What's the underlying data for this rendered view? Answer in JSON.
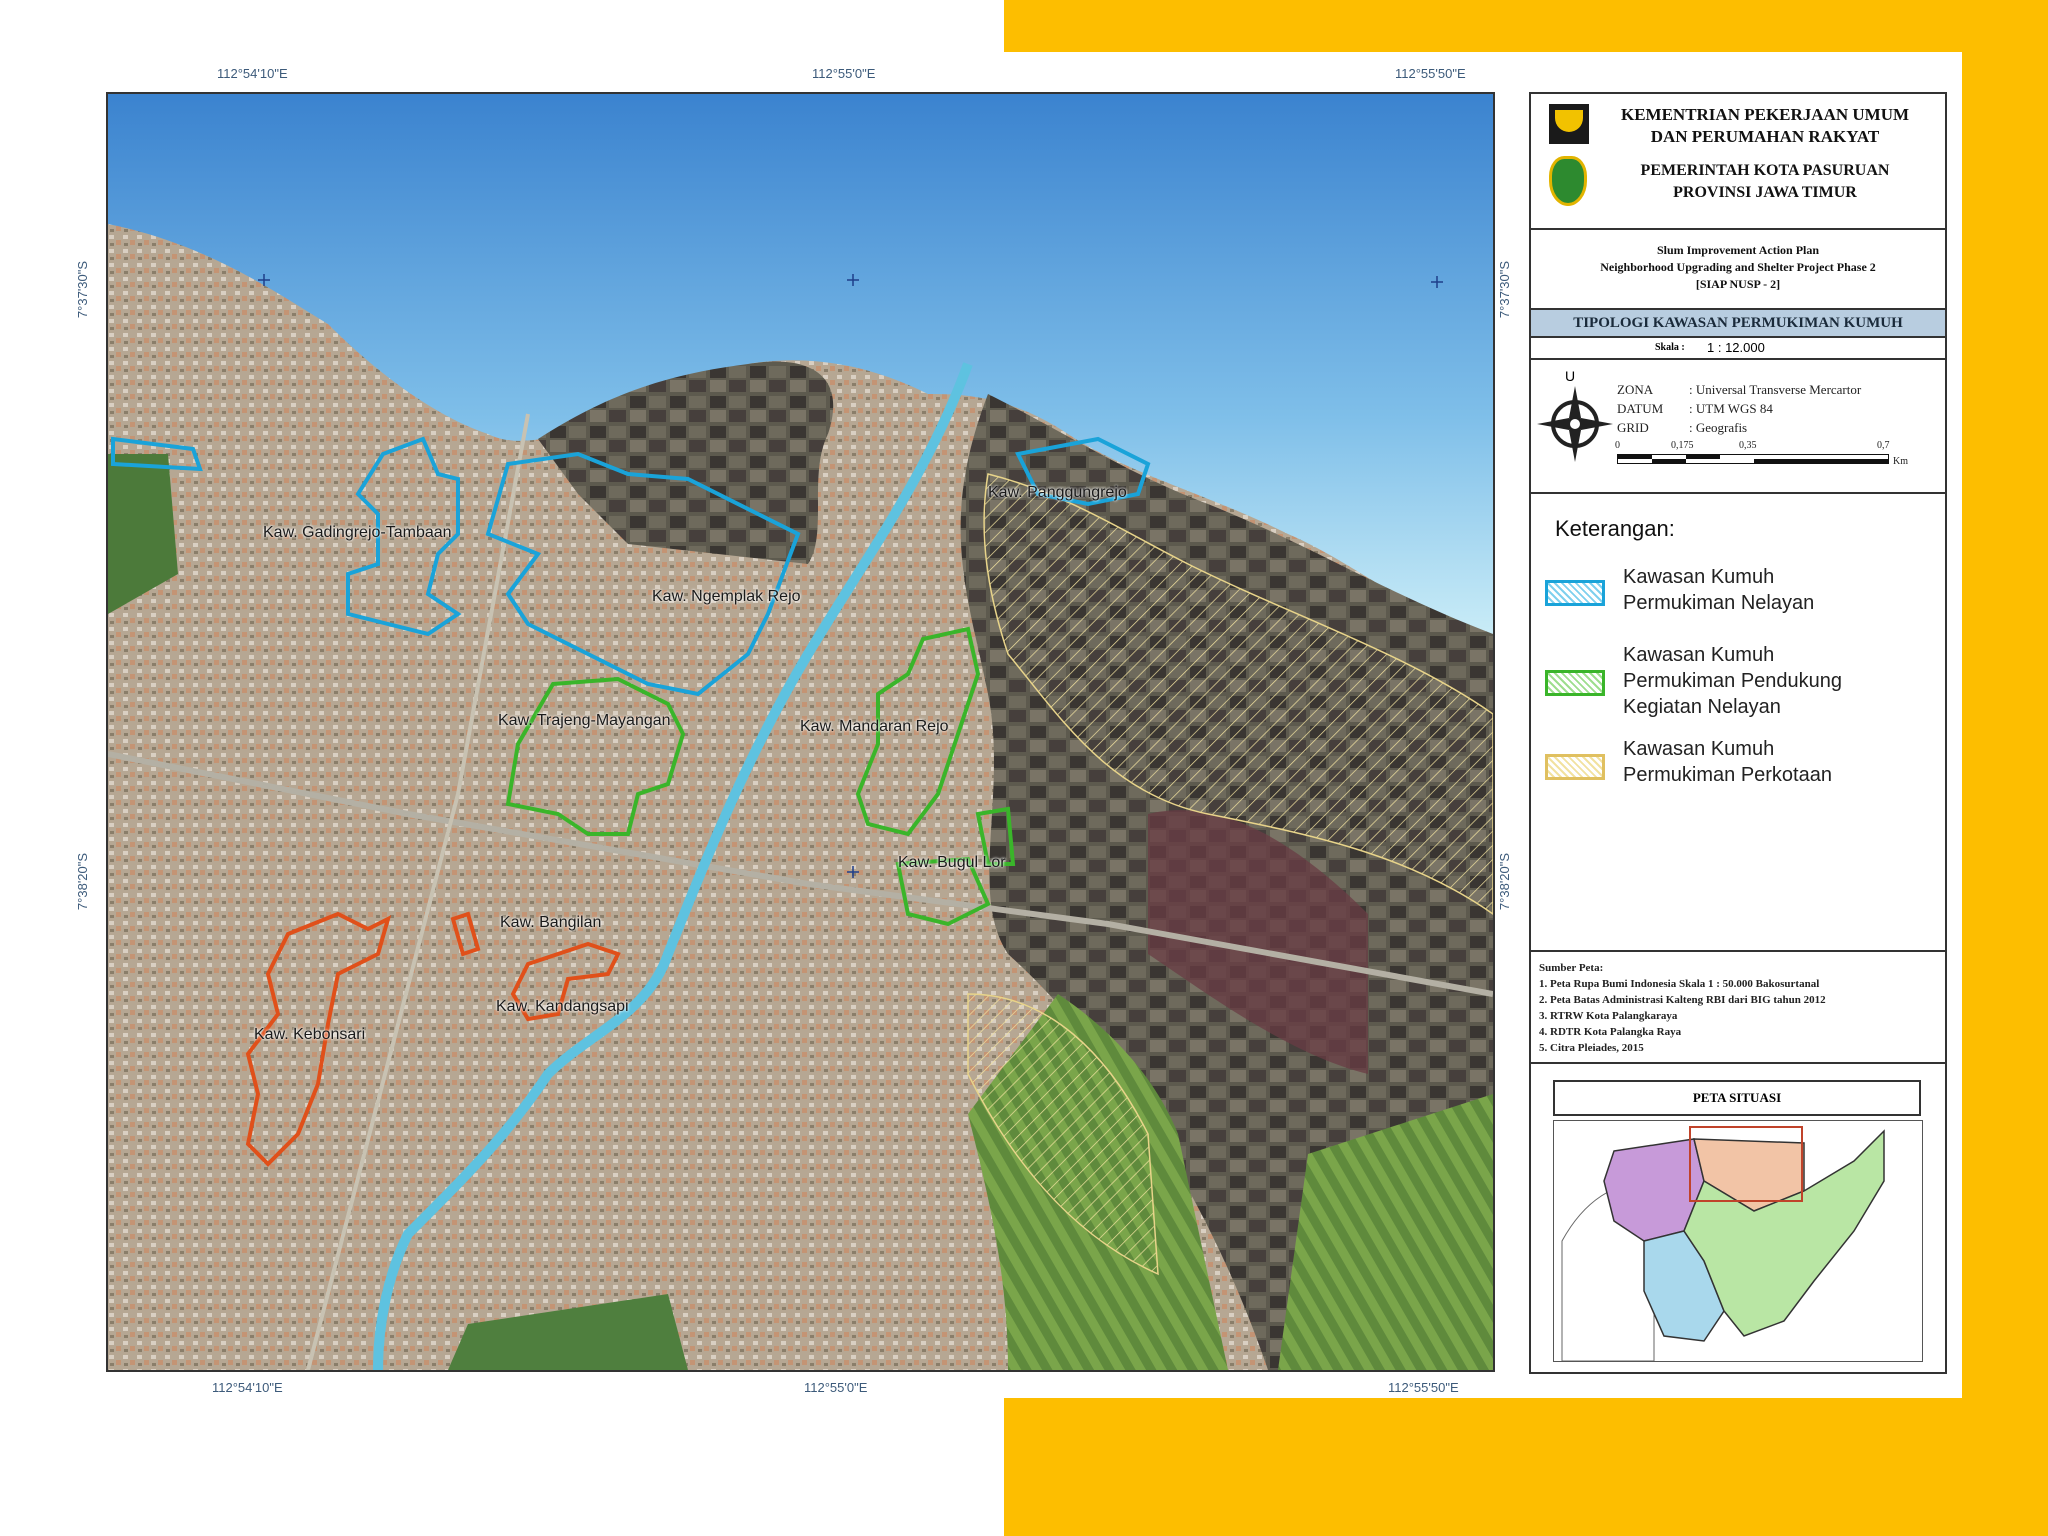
{
  "coords": {
    "top": [
      "112°54'10\"E",
      "112°55'0\"E",
      "112°55'50\"E"
    ],
    "bottom": [
      "112°54'10\"E",
      "112°55'0\"E",
      "112°55'50\"E"
    ],
    "left": [
      "7°37'30\"S",
      "7°38'20\"S"
    ],
    "right": [
      "7°37'30\"S",
      "7°38'20\"S"
    ]
  },
  "map_labels": {
    "gadingrejo": "Kaw. Gadingrejo-Tambaan",
    "ngemplak": "Kaw. Ngemplak Rejo",
    "panggungrejo": "Kaw. Panggungrejo",
    "trajeng": "Kaw. Trajeng-Mayangan",
    "mandaran": "Kaw. Mandaran Rejo",
    "bugul": "Kaw. Bugul Lor",
    "bangilan": "Kaw. Bangilan",
    "kebonsari": "Kaw. Kebonsari",
    "kandangsapi": "Kaw. Kandangsapi"
  },
  "header": {
    "ministry_line1": "KEMENTRIAN PEKERJAAN UMUM",
    "ministry_line2": "DAN PERUMAHAN RAKYAT",
    "gov_line1": "PEMERINTAH KOTA PASURUAN",
    "gov_line2": "PROVINSI JAWA TIMUR"
  },
  "project": {
    "line1": "Slum Improvement Action Plan",
    "line2": "Neighborhood Upgrading and Shelter Project Phase 2",
    "line3": "[SIAP NUSP - 2]"
  },
  "map_title": "TIPOLOGI KAWASAN PERMUKIMAN KUMUH",
  "scale": {
    "label": "Skala :",
    "value": "1 : 12.000"
  },
  "projection": {
    "zona_label": "ZONA",
    "zona_value": ": Universal Transverse Mercartor",
    "datum_label": "DATUM",
    "datum_value": ": UTM WGS 84",
    "grid_label": "GRID",
    "grid_value": ": Geografis",
    "north": "U",
    "ticks": [
      "0",
      "0,175",
      "0,35",
      "0,7"
    ],
    "unit": "Km"
  },
  "legend": {
    "title": "Keterangan:",
    "items": [
      {
        "line1": "Kawasan Kumuh",
        "line2": "Permukiman Nelayan",
        "line3": "",
        "color": "#1aa3d9"
      },
      {
        "line1": "Kawasan Kumuh",
        "line2": "Permukiman Pendukung",
        "line3": "Kegiatan Nelayan",
        "color": "#3ab52a"
      },
      {
        "line1": "Kawasan Kumuh",
        "line2": "Permukiman Perkotaan",
        "line3": "",
        "color": "#e0c060"
      }
    ]
  },
  "sources": {
    "title": "Sumber Peta:",
    "items": [
      "1. Peta Rupa Bumi Indonesia Skala 1 : 50.000 Bakosurtanal",
      "2. Peta Batas Administrasi Kalteng RBI dari BIG tahun 2012",
      "3. RTRW Kota Palangkaraya",
      "4. RDTR Kota Palangka Raya",
      "5. Citra Pleiades, 2015"
    ]
  },
  "situasi": {
    "title": "PETA SITUASI"
  },
  "colors": {
    "accent": "#FDBE00",
    "nelayan": "#1aa3d9",
    "pendukung": "#3ab52a",
    "perkotaan": "#e0501a"
  }
}
